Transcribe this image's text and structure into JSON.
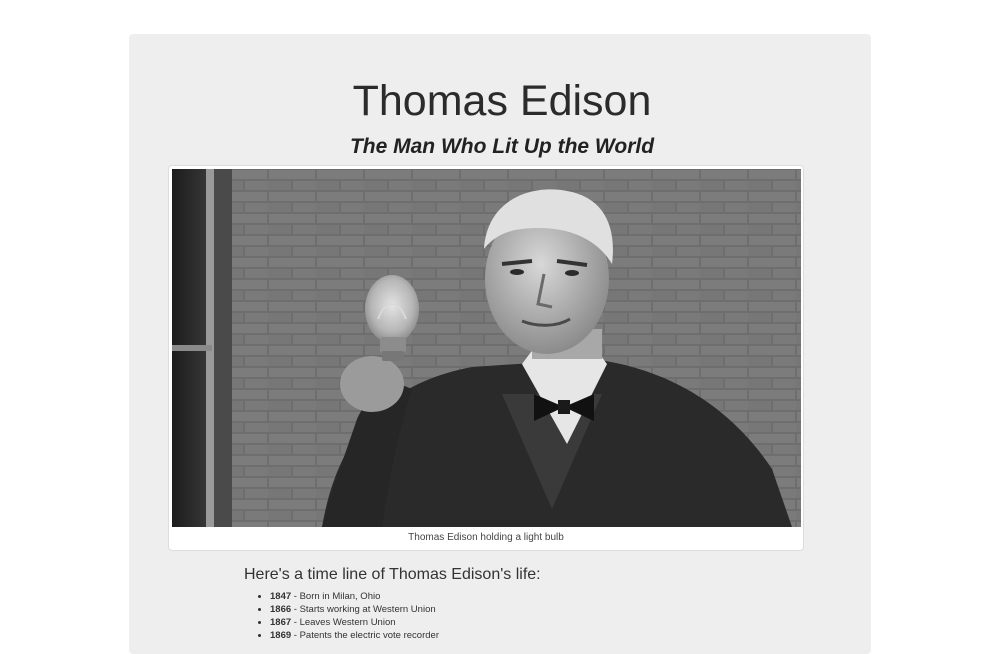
{
  "page": {
    "title": "Thomas Edison",
    "subtitle": "The Man Who Lit Up the World"
  },
  "figure": {
    "image_icon": "portrait-photo",
    "caption": "Thomas Edison holding a light bulb"
  },
  "timeline": {
    "heading": "Here's a time line of Thomas Edison's life:",
    "items": [
      {
        "year": "1847",
        "text": " - Born in Milan, Ohio"
      },
      {
        "year": "1866",
        "text": " - Starts working at Western Union"
      },
      {
        "year": "1867",
        "text": " - Leaves Western Union"
      },
      {
        "year": "1869",
        "text": " - Patents the electric vote recorder"
      }
    ]
  }
}
